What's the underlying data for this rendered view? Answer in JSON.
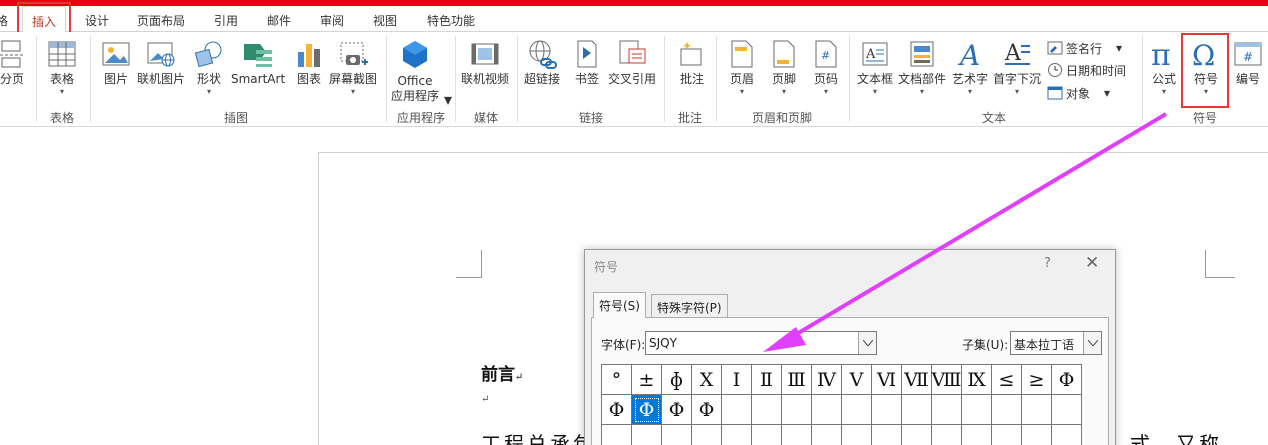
{
  "tabs": [
    {
      "label": "格"
    },
    {
      "label": "插入"
    },
    {
      "label": "设计"
    },
    {
      "label": "页面布局"
    },
    {
      "label": "引用"
    },
    {
      "label": "邮件"
    },
    {
      "label": "审阅"
    },
    {
      "label": "视图"
    },
    {
      "label": "特色功能"
    }
  ],
  "ribbon": {
    "pages": {
      "page_break": "分页"
    },
    "table": {
      "table": "表格",
      "group": "表格"
    },
    "illustrations": {
      "picture": "图片",
      "online_picture": "联机图片",
      "shapes": "形状",
      "smartart": "SmartArt",
      "chart": "图表",
      "screenshot": "屏幕截图",
      "group": "插图"
    },
    "apps": {
      "office_line1": "Office",
      "office_line2": "应用程序",
      "group": "应用程序"
    },
    "media": {
      "online_video": "联机视频",
      "group": "媒体"
    },
    "links": {
      "hyperlink": "超链接",
      "bookmark": "书签",
      "cross_ref": "交叉引用",
      "group": "链接"
    },
    "comments": {
      "comment": "批注",
      "group": "批注"
    },
    "header_footer": {
      "header": "页眉",
      "footer": "页脚",
      "page_number": "页码",
      "group": "页眉和页脚"
    },
    "text": {
      "textbox": "文本框",
      "quick_parts": "文档部件",
      "wordart": "艺术字",
      "dropcap": "首字下沉",
      "signature": "签名行",
      "datetime": "日期和时间",
      "object": "对象",
      "group": "文本"
    },
    "symbols": {
      "equation": "公式",
      "symbol": "符号",
      "numbering": "编号",
      "group": "符号"
    }
  },
  "document": {
    "heading": "前言",
    "body_left": "工程总承包",
    "body_right": "式，又称",
    "para_mark": "↵"
  },
  "dialog": {
    "title": "符号",
    "help": "?",
    "close": "✕",
    "tab_symbols": "符号(S)",
    "tab_special": "特殊字符(P)",
    "font_label": "字体(F):",
    "font_value": "SJQY",
    "subset_label": "子集(U):",
    "subset_value": "基本拉丁语",
    "grid_rows": [
      [
        "°",
        "±",
        "ɸ",
        "Χ",
        "Ⅰ",
        "Ⅱ",
        "Ⅲ",
        "Ⅳ",
        "Ⅴ",
        "Ⅵ",
        "Ⅶ",
        "Ⅷ",
        "Ⅸ",
        "≤",
        "≥",
        "Φ"
      ],
      [
        "Φ",
        "Φ",
        "Φ",
        "Φ",
        "",
        "",
        "",
        "",
        "",
        "",
        "",
        "",
        "",
        "",
        "",
        ""
      ],
      [
        "",
        "",
        "",
        "",
        "",
        "",
        "",
        "",
        "",
        "",
        "",
        "",
        "",
        "",
        "",
        ""
      ]
    ],
    "selected_cell": "1,1"
  },
  "colors": {
    "accent_red": "#e60012",
    "highlight_box": "#e53935",
    "arrow": "#e040fb",
    "selection": "#0078d7"
  }
}
